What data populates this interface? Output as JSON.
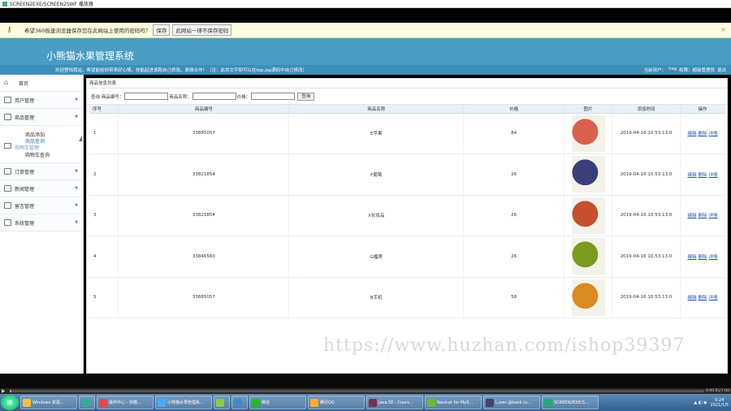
{
  "player": {
    "title": "SCREEN2EXE/SCREEN2SWF 播放器"
  },
  "notify": {
    "message": "希望360极速浏览器保存您在此网站上使用的密码吗？",
    "save_label": "保存",
    "never_label": "此网站一律不保存密码",
    "close": "×"
  },
  "header": {
    "title": "小熊猫水果管理系统"
  },
  "subbar": {
    "welcome": "欢迎登陆我站，希望能给你带来好心情，技能起进请跑自己修改，谢谢合作！（注：此状文字即可以在top.jsp源码中自己修改）",
    "current_user": "当前用户：",
    "user": "hsg",
    "role": "权限：超级管理员",
    "logout": "退出"
  },
  "sidebar": {
    "home": "首页",
    "items_top": [
      {
        "label": "用户管理"
      },
      {
        "label": "商品管理"
      }
    ],
    "product_sub": [
      "商品添加",
      "商品查询",
      "购物车查询"
    ],
    "product_sub_ghost": "购物车管理",
    "items_bottom": [
      {
        "label": "订单管理"
      },
      {
        "label": "新闻管理"
      },
      {
        "label": "留言管理"
      },
      {
        "label": "系统管理"
      }
    ]
  },
  "panel": {
    "title": "商品信息列表"
  },
  "search": {
    "label_code": "查询 商品编号：",
    "label_name": "商品名称：",
    "label_price": "价格：",
    "button": "查询"
  },
  "table": {
    "headers": [
      "序号",
      "商品编号",
      "商品名称",
      "价格",
      "图片",
      "添加时间",
      "操作"
    ],
    "rows": [
      {
        "idx": "1",
        "code": "33885057",
        "name": "E苹果",
        "price": "84",
        "time": "2019-04-16 10:53:13.0",
        "img_color": "#d9604c"
      },
      {
        "idx": "2",
        "code": "33821854",
        "name": "F葡萄",
        "price": "26",
        "time": "2019-04-16 10:53:13.0",
        "img_color": "#3a3f7a"
      },
      {
        "idx": "3",
        "code": "33821854",
        "name": "X化妆品",
        "price": "26",
        "time": "2019-04-16 10:53:13.0",
        "img_color": "#c4502e"
      },
      {
        "idx": "4",
        "code": "33846560",
        "name": "G榴莲",
        "price": "26",
        "time": "2019-04-16 10:53:13.0",
        "img_color": "#7a9a20"
      },
      {
        "idx": "5",
        "code": "33885057",
        "name": "B手机",
        "price": "58",
        "time": "2019-04-16 10:53:13.0",
        "img_color": "#d98a20"
      }
    ],
    "op_edit": "编辑",
    "op_delete": "删除",
    "op_detail": "详情"
  },
  "watermark": "https://www.huzhan.com/ishop39397",
  "controls": {
    "time": "0:00:01/7:00:1",
    "progress": 0.002
  },
  "taskbar": {
    "items": [
      {
        "label": "Windows 资源...",
        "color": "#f0c040"
      },
      {
        "label": "",
        "color": "#3a9"
      },
      {
        "label": "操作中心 - 商橙...",
        "color": "#e44"
      },
      {
        "label": "小熊猫水果管理系...",
        "color": "#4af"
      },
      {
        "label": "",
        "color": "#8c4"
      },
      {
        "label": "",
        "color": "#48c"
      },
      {
        "label": "微信",
        "color": "#2b2"
      },
      {
        "label": "腾讯QQ",
        "color": "#fa3"
      },
      {
        "label": "Java EE - Cours...",
        "color": "#735"
      },
      {
        "label": "Navicat for MyS...",
        "color": "#6b3"
      },
      {
        "label": "Luser @book (o...",
        "color": "#446"
      },
      {
        "label": "SCREEN2EXE/S...",
        "color": "#2a7"
      }
    ],
    "time": "0:24",
    "date": "2021/1/5"
  }
}
